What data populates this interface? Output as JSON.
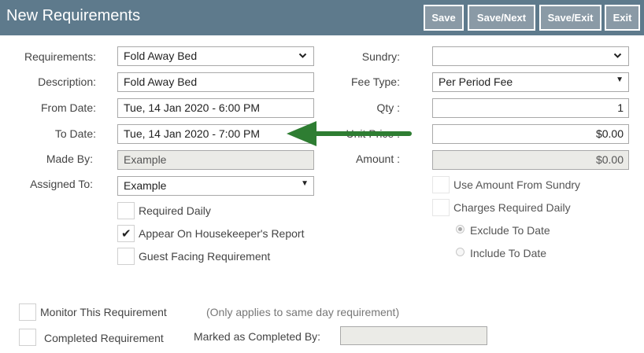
{
  "header": {
    "title": "New Requirements",
    "buttons": {
      "save": "Save",
      "save_next": "Save/Next",
      "save_exit": "Save/Exit",
      "exit": "Exit"
    },
    "color": "#5e7a8c"
  },
  "form": {
    "requirements": {
      "label": "Requirements:",
      "value": "Fold Away Bed"
    },
    "description": {
      "label": "Description:",
      "value": "Fold Away Bed"
    },
    "from_date": {
      "label": "From Date:",
      "value": "Tue, 14 Jan 2020 - 6:00 PM"
    },
    "to_date": {
      "label": "To Date:",
      "value": "Tue, 14 Jan 2020 - 7:00 PM"
    },
    "made_by": {
      "label": "Made By:",
      "value": "Example"
    },
    "assigned_to": {
      "label": "Assigned To:",
      "value": "Example"
    },
    "sundry": {
      "label": "Sundry:",
      "value": ""
    },
    "fee_type": {
      "label": "Fee Type:",
      "value": "Per Period Fee"
    },
    "qty": {
      "label": "Qty :",
      "value": "1"
    },
    "unit_price": {
      "label": "Unit Price :",
      "value": "$0.00"
    },
    "amount": {
      "label": "Amount :",
      "value": "$0.00"
    }
  },
  "checkboxes": {
    "required_daily": {
      "label": "Required Daily",
      "checked": false
    },
    "appear_on_housekeeper": {
      "label": "Appear On Housekeeper's Report",
      "checked": true
    },
    "guest_facing": {
      "label": "Guest Facing Requirement",
      "checked": false
    },
    "use_amount_from_sundry": {
      "label": "Use Amount From Sundry",
      "checked": false
    },
    "charges_required_daily": {
      "label": "Charges Required Daily",
      "checked": false
    },
    "monitor_requirement": {
      "label": "Monitor This Requirement",
      "checked": false
    },
    "completed_requirement": {
      "label": "Completed Requirement",
      "checked": false
    }
  },
  "radios": {
    "exclude_to_date": {
      "label": "Exclude To Date",
      "selected": true
    },
    "include_to_date": {
      "label": "Include To Date",
      "selected": false
    }
  },
  "monitor_note": "(Only applies to same day requirement)",
  "marked_completed_by": {
    "label": "Marked as Completed By:",
    "value": ""
  },
  "annotation": {
    "arrow_color": "#2e7d32"
  }
}
